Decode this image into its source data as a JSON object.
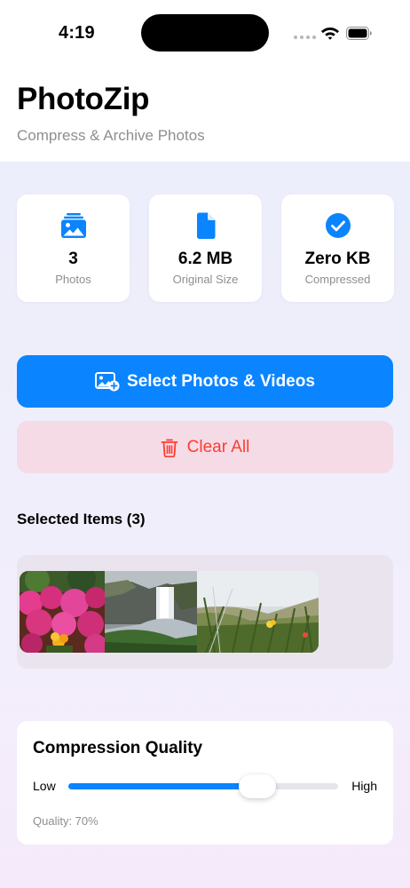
{
  "status_bar": {
    "time": "4:19"
  },
  "header": {
    "title": "PhotoZip",
    "subtitle": "Compress & Archive Photos"
  },
  "stats": [
    {
      "icon": "photo-stack-icon",
      "value": "3",
      "label": "Photos"
    },
    {
      "icon": "document-icon",
      "value": "6.2 MB",
      "label": "Original Size"
    },
    {
      "icon": "checkmark-circle-icon",
      "value": "Zero KB",
      "label": "Compressed"
    }
  ],
  "actions": {
    "select_label": "Select Photos & Videos",
    "clear_label": "Clear All"
  },
  "selected": {
    "title": "Selected Items (3)",
    "items": [
      "flowers",
      "waterfall",
      "grass"
    ]
  },
  "quality": {
    "title": "Compression Quality",
    "low_label": "Low",
    "high_label": "High",
    "value": 0.7,
    "caption": "Quality: 70%"
  },
  "colors": {
    "accent": "#0a84ff",
    "destructive": "#ff3b30",
    "destructive_bg": "#f5dbe6"
  }
}
